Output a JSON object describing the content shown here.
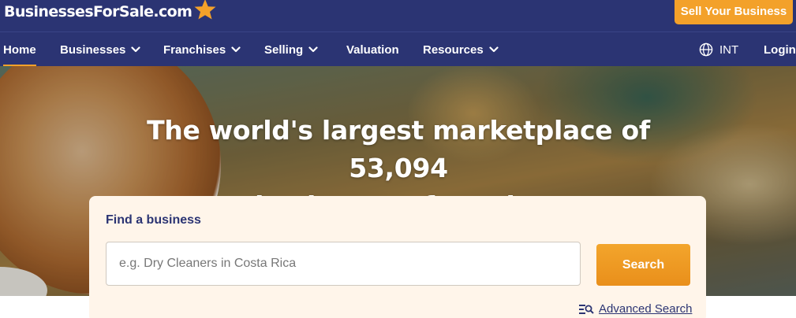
{
  "brand": {
    "name": "BusinessesForSale.com",
    "accent_color": "#f3a12a",
    "nav_bg_color": "#2b3473"
  },
  "header": {
    "sell_button_label": "Sell Your Business"
  },
  "nav": {
    "home": "Home",
    "businesses": "Businesses",
    "franchises": "Franchises",
    "selling": "Selling",
    "valuation": "Valuation",
    "resources": "Resources",
    "region": "INT",
    "login": "Login",
    "active_item": "Home"
  },
  "hero": {
    "title_line1": "The world's largest marketplace of 53,094",
    "title_line2": "businesses for sale."
  },
  "search": {
    "heading": "Find a business",
    "placeholder": "e.g. Dry Cleaners in Costa Rica",
    "value": "",
    "button_label": "Search",
    "advanced_link": "Advanced Search"
  },
  "icons": {
    "logo_star": "star-icon",
    "nav_chevron": "chevron-down-icon",
    "region": "globe-icon",
    "advanced": "filter-search-icon"
  }
}
